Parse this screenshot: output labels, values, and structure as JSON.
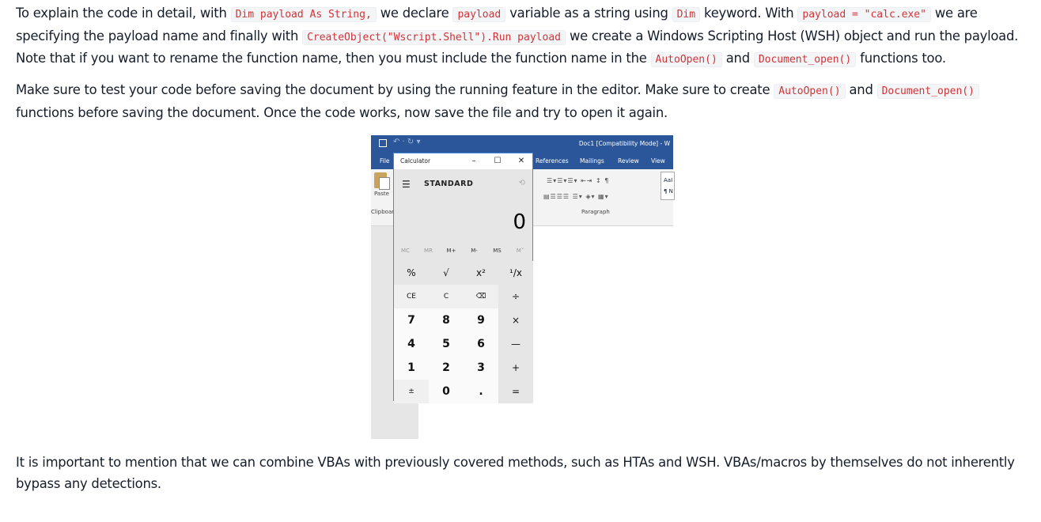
{
  "para1": {
    "t1": "To explain the code in detail, with ",
    "c1": "Dim payload As String,",
    "t2": " we declare ",
    "c2": "payload",
    "t3": " variable as a string using ",
    "c3": "Dim",
    "t4": " keyword. With ",
    "c4": "payload = \"calc.exe\"",
    "t5": " we are specifying the payload name and finally with ",
    "c5": "CreateObject(\"Wscript.Shell\").Run payload",
    "t6": " we create a Windows Scripting Host (WSH) object and run the payload. Note that if you want to rename the function name, then you must include the function name in the ",
    "c6": "AutoOpen()",
    "t7": " and ",
    "c7": "Document_open()",
    "t8": " functions too."
  },
  "para2": {
    "t1": "Make sure to test your code before saving the document by using the running feature in the editor. Make sure to create ",
    "c1": "AutoOpen()",
    "t2": " and ",
    "c2": "Document_open()",
    "t3": " functions before saving the document. Once the code works, now save the file and try to open it again."
  },
  "para3": "It is important to mention that we can combine VBAs with previously covered methods, such as HTAs and WSH. VBAs/macros by themselves do not inherently bypass any detections.",
  "word": {
    "doc_title": "Doc1 [Compatibility Mode] - W",
    "tabs": [
      "File",
      "References",
      "Mailings",
      "Review",
      "View"
    ],
    "paste": "Paste",
    "clipboard": "Clipboar",
    "paragraph": "Paragraph",
    "style_sample": "AaI",
    "style_sample2": "¶ N"
  },
  "calculator": {
    "title": "Calculator",
    "mode": "STANDARD",
    "display": "0",
    "memory": [
      "MC",
      "MR",
      "M+",
      "M-",
      "MS",
      "M˅"
    ],
    "keys": [
      [
        "%",
        "√",
        "x²",
        "¹/x"
      ],
      [
        "CE",
        "C",
        "⌫",
        "÷"
      ],
      [
        "7",
        "8",
        "9",
        "×"
      ],
      [
        "4",
        "5",
        "6",
        "—"
      ],
      [
        "1",
        "2",
        "3",
        "+"
      ],
      [
        "±",
        "0",
        ".",
        "="
      ]
    ]
  }
}
